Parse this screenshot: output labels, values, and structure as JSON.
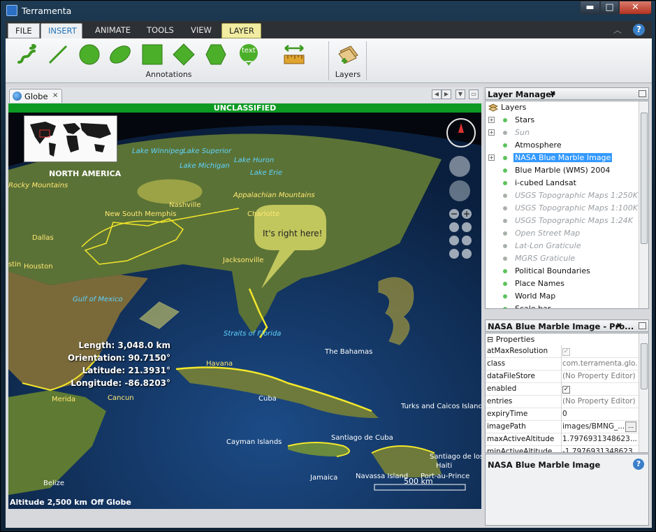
{
  "window": {
    "title": "Terramenta",
    "min": "▬",
    "max": "□",
    "close": "✕"
  },
  "ribbon": {
    "tabs": [
      "FILE",
      "INSERT",
      "ANIMATE",
      "TOOLS",
      "VIEW",
      "LAYER"
    ],
    "active_tab": "INSERT",
    "annotations_group_label": "Annotations",
    "layers_group_label": "Layers",
    "text_tool_label": "text"
  },
  "globe_tab": {
    "label": "Globe",
    "close": "×"
  },
  "globe": {
    "banner": "UNCLASSIFIED",
    "continent": "NORTH AMERICA",
    "lakes": [
      "Lake Winnipeg",
      "Lake Superior",
      "Lake Michigan",
      "Lake Huron",
      "Lake Erie"
    ],
    "places": [
      "Nashville",
      "Appalachian Mountains",
      "New South Memphis",
      "Charlotte",
      "Dallas",
      "Houston",
      "Jacksonville",
      "Havana",
      "Merida",
      "Cancun",
      "Cuba",
      "The Bahamas",
      "Cayman Islands",
      "Santiago de Cuba",
      "Turks and Caicos Islands",
      "Belize",
      "Jamaica",
      "Navassa Island",
      "Santiago de los",
      "Port-au-Prince",
      "Haiti"
    ],
    "rocky": "Rocky Mountains",
    "stin": "stin",
    "gulf": "Gulf of Mexico",
    "straits": "Straits of Florida",
    "callout": "It's right here!",
    "measure": {
      "length_label": "Length:",
      "length": "3,048.0 km",
      "orientation_label": "Orientation:",
      "orientation": "90.7150°",
      "latitude_label": "Latitude:",
      "latitude": "21.3931°",
      "longitude_label": "Longitude:",
      "longitude": "-86.8203°"
    },
    "scale": "500 km",
    "altitude": "Altitude 2,500 km",
    "position": "Off Globe"
  },
  "layer_manager": {
    "title": "Layer Manager",
    "root": "Layers",
    "items": [
      {
        "name": "Stars",
        "enabled": true,
        "expandable": true
      },
      {
        "name": "Sun",
        "enabled": false,
        "expandable": true
      },
      {
        "name": "Atmosphere",
        "enabled": true,
        "expandable": false
      },
      {
        "name": "NASA Blue Marble Image",
        "enabled": true,
        "expandable": true,
        "selected": true
      },
      {
        "name": "Blue Marble (WMS) 2004",
        "enabled": true,
        "expandable": false
      },
      {
        "name": "i-cubed Landsat",
        "enabled": true,
        "expandable": false
      },
      {
        "name": "USGS Topographic Maps 1:250K",
        "enabled": false,
        "expandable": false
      },
      {
        "name": "USGS Topographic Maps 1:100K",
        "enabled": false,
        "expandable": false
      },
      {
        "name": "USGS Topographic Maps 1:24K",
        "enabled": false,
        "expandable": false
      },
      {
        "name": "Open Street Map",
        "enabled": false,
        "expandable": false
      },
      {
        "name": "Lat-Lon Graticule",
        "enabled": false,
        "expandable": false
      },
      {
        "name": "MGRS Graticule",
        "enabled": false,
        "expandable": false
      },
      {
        "name": "Political Boundaries",
        "enabled": true,
        "expandable": false
      },
      {
        "name": "Place Names",
        "enabled": true,
        "expandable": false
      },
      {
        "name": "World Map",
        "enabled": true,
        "expandable": false
      },
      {
        "name": "Scale bar",
        "enabled": true,
        "expandable": false
      }
    ]
  },
  "properties_panel": {
    "title": "NASA Blue Marble Image - Pro...",
    "section": "Properties",
    "rows": [
      {
        "key": "atMaxResolution",
        "value": "",
        "type": "check-disabled"
      },
      {
        "key": "class",
        "value": "com.terramenta.glo...",
        "type": "gray"
      },
      {
        "key": "dataFileStore",
        "value": "(No Property Editor)",
        "type": "gray"
      },
      {
        "key": "enabled",
        "value": "",
        "type": "check"
      },
      {
        "key": "entries",
        "value": "(No Property Editor)",
        "type": "gray"
      },
      {
        "key": "expiryTime",
        "value": "0",
        "type": "text"
      },
      {
        "key": "imagePath",
        "value": "images/BMNG_...",
        "type": "text"
      },
      {
        "key": "maxActiveAltitude",
        "value": "1.7976931348623...",
        "type": "text"
      },
      {
        "key": "minActiveAltitude",
        "value": "-1.7976931348623...",
        "type": "text"
      }
    ],
    "description_title": "NASA Blue Marble Image",
    "ellipsis": "..."
  },
  "colors": {
    "accent": "#3399ff",
    "banner": "#0c9a23",
    "annotation_yellow": "#f5ea3a",
    "ribbon_icon_green": "#4caf2a"
  }
}
